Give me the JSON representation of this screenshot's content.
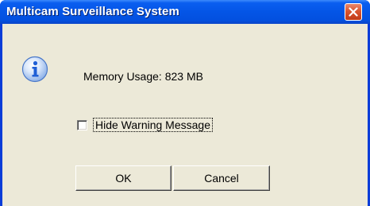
{
  "window": {
    "title": "Multicam Surveillance System"
  },
  "dialog": {
    "icon": "info-icon",
    "message": "Memory Usage: 823 MB",
    "checkbox": {
      "label": "Hide Warning Message",
      "checked": false
    },
    "buttons": {
      "ok_label": "OK",
      "cancel_label": "Cancel"
    }
  },
  "colors": {
    "titlebar": "#0455e6",
    "client_background": "#ece9d8",
    "close_button": "#d9552f",
    "info_icon": "#1f5fd6"
  }
}
